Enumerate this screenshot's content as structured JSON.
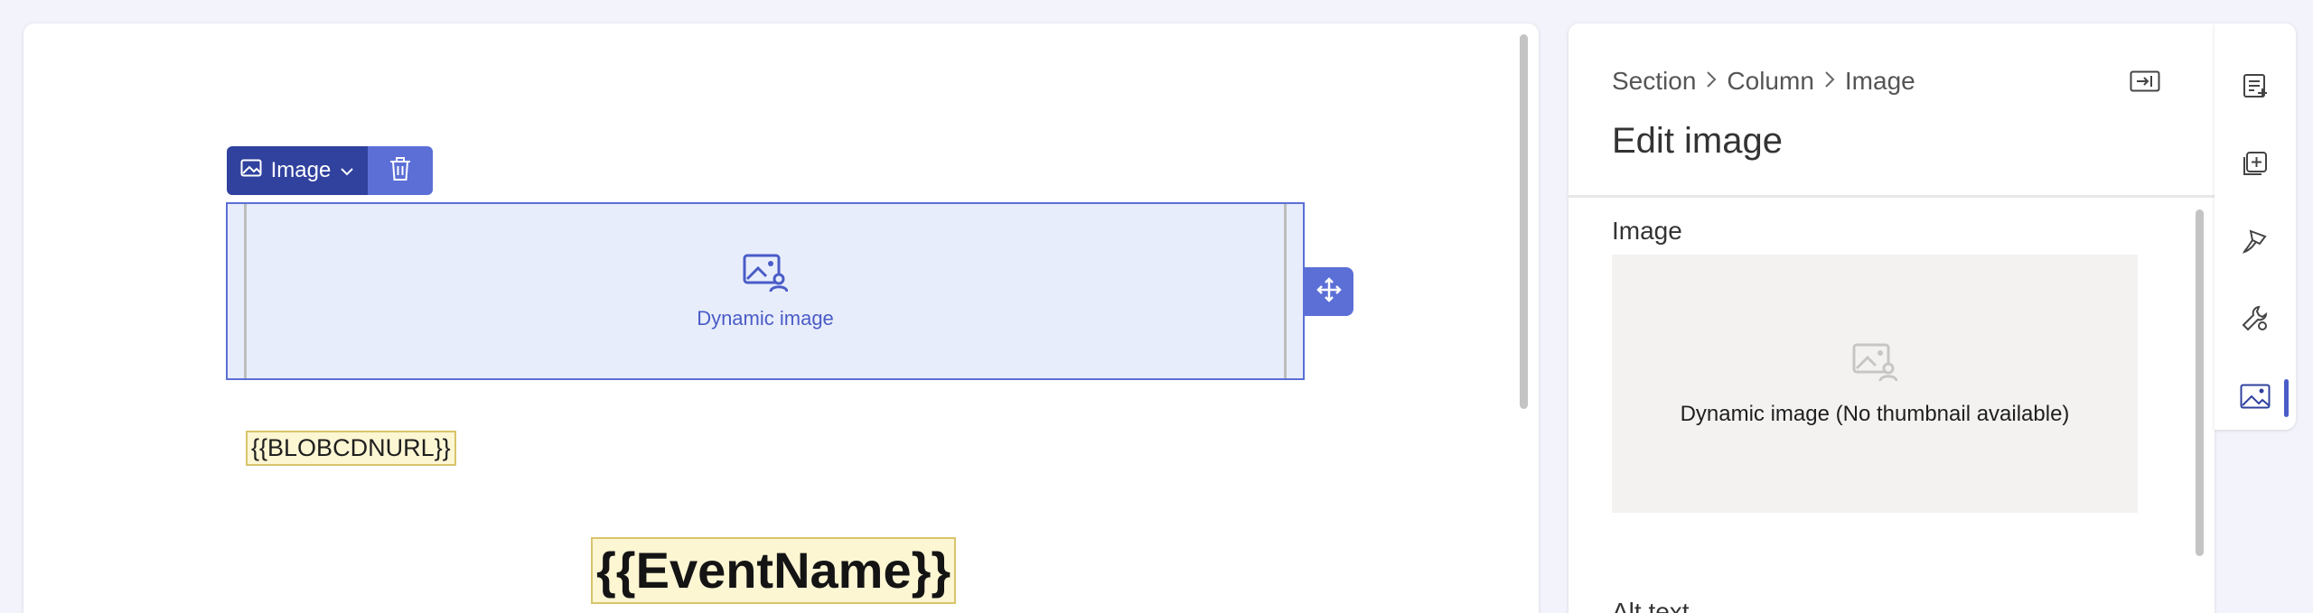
{
  "canvas": {
    "toolbar": {
      "label": "Image"
    },
    "dynamic_image_label": "Dynamic image",
    "token_blob": "{{BLOBCDNURL}}",
    "token_event": "{{EventName}}"
  },
  "panel": {
    "breadcrumb": [
      "Section",
      "Column",
      "Image"
    ],
    "title": "Edit image",
    "image_section_label": "Image",
    "thumbnail_text": "Dynamic image (No thumbnail available)",
    "alt_text_label": "Alt text"
  },
  "rail": {
    "items": [
      {
        "icon": "add-element-icon"
      },
      {
        "icon": "add-section-icon"
      },
      {
        "icon": "paintbrush-icon"
      },
      {
        "icon": "settings-wrench-icon"
      },
      {
        "icon": "image-properties-icon",
        "active": true
      }
    ]
  },
  "colors": {
    "accent": "#5b6fd6",
    "accent_dark": "#30419e",
    "token_bg": "#fcf6d3",
    "token_border": "#d9c46c",
    "active_indicator": "#4a5cc7"
  }
}
